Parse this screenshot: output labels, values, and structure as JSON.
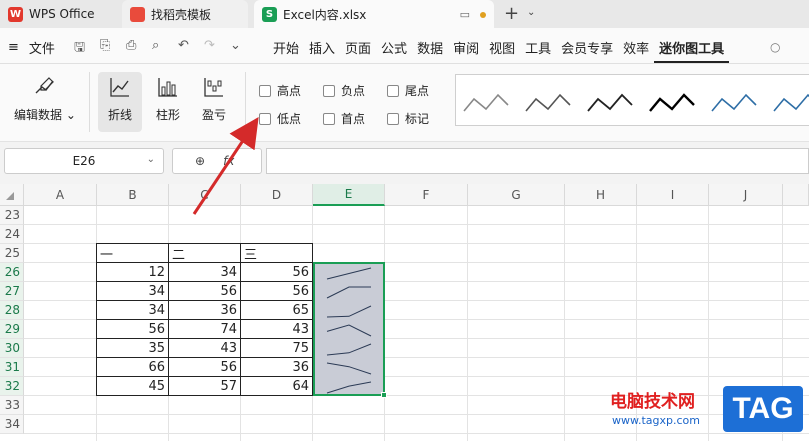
{
  "tabs": [
    {
      "label": "WPS Office",
      "icon": "wps-logo-icon"
    },
    {
      "label": "找稻壳模板",
      "icon": "docer-logo-icon"
    },
    {
      "label": "Excel内容.xlsx",
      "icon": "sheet-logo-icon"
    }
  ],
  "menu": {
    "file": "文件",
    "items": [
      "开始",
      "插入",
      "页面",
      "公式",
      "数据",
      "审阅",
      "视图",
      "工具",
      "会员专享",
      "效率",
      "迷你图工具"
    ],
    "active": "迷你图工具"
  },
  "ribbon": {
    "edit_data": "编辑数据",
    "line": "折线",
    "column": "柱形",
    "winloss": "盈亏",
    "checks": [
      {
        "label": "高点"
      },
      {
        "label": "负点"
      },
      {
        "label": "尾点"
      },
      {
        "label": "低点"
      },
      {
        "label": "首点"
      },
      {
        "label": "标记"
      }
    ]
  },
  "formula_bar": {
    "cell_ref": "E26",
    "fx": "fx"
  },
  "sheet": {
    "columns": [
      "A",
      "B",
      "C",
      "D",
      "E",
      "F",
      "G",
      "H",
      "I",
      "J"
    ],
    "selected_column": "E",
    "rows": [
      "23",
      "24",
      "25",
      "26",
      "27",
      "28",
      "29",
      "30",
      "31",
      "32",
      "33",
      "34"
    ],
    "headers": [
      "一",
      "二",
      "三"
    ],
    "data": [
      [
        12,
        34,
        56
      ],
      [
        34,
        56,
        56
      ],
      [
        34,
        36,
        65
      ],
      [
        56,
        74,
        43
      ],
      [
        35,
        43,
        75
      ],
      [
        66,
        56,
        36
      ],
      [
        45,
        57,
        64
      ]
    ]
  },
  "watermark": {
    "text": "电脑技术网",
    "url": "www.tagxp.com",
    "tag": "TAG"
  },
  "colors": {
    "accent_green": "#1a9e55",
    "arrow_red": "#d42a2a"
  }
}
